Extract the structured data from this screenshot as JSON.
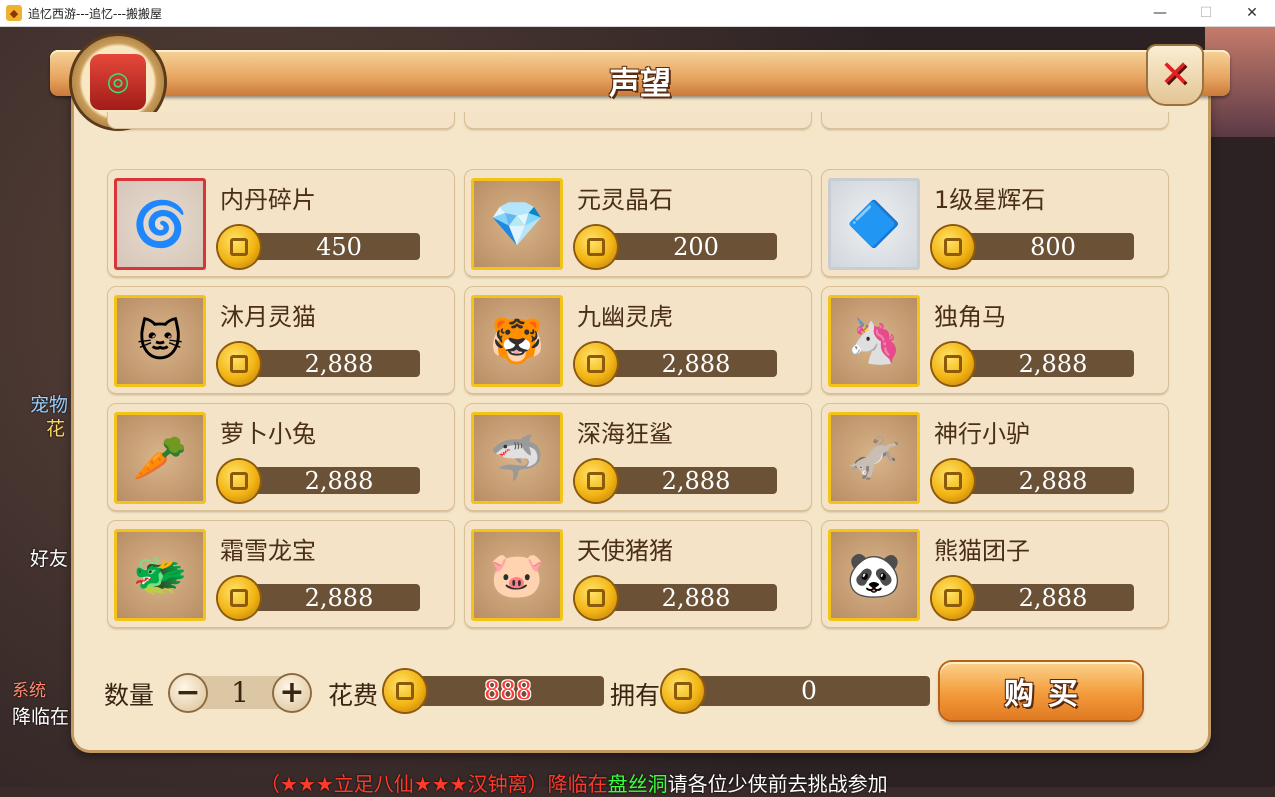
{
  "window": {
    "title": "追忆西游---追忆---搬搬屋",
    "minimize": "—",
    "maximize": "☐",
    "close": "✕"
  },
  "background": {
    "side_texts": [
      "宠物",
      "花",
      "好友",
      "系统",
      "降临在"
    ],
    "bottom_parts": [
      "（★★★立足八仙★★★汉钟离）降临在",
      "盘丝洞",
      "请各位少侠前去挑战参加"
    ]
  },
  "panel": {
    "title": "声望",
    "close_icon": "close-x-icon"
  },
  "items": [
    {
      "name": "内丹碎片",
      "price": "450",
      "icon": "🌀",
      "frame": "red"
    },
    {
      "name": "元灵晶石",
      "price": "200",
      "icon": "💎",
      "frame": "gold"
    },
    {
      "name": "1级星辉石",
      "price": "800",
      "icon": "🔷",
      "frame": "silver"
    },
    {
      "name": "沐月灵猫",
      "price": "2,888",
      "icon": "🐱",
      "frame": "gold"
    },
    {
      "name": "九幽灵虎",
      "price": "2,888",
      "icon": "🐯",
      "frame": "gold"
    },
    {
      "name": "独角马",
      "price": "2,888",
      "icon": "🦄",
      "frame": "gold"
    },
    {
      "name": "萝卜小兔",
      "price": "2,888",
      "icon": "🥕",
      "frame": "gold"
    },
    {
      "name": "深海狂鲨",
      "price": "2,888",
      "icon": "🦈",
      "frame": "gold"
    },
    {
      "name": "神行小驴",
      "price": "2,888",
      "icon": "🫏",
      "frame": "gold"
    },
    {
      "name": "霜雪龙宝",
      "price": "2,888",
      "icon": "🐲",
      "frame": "gold"
    },
    {
      "name": "天使猪猪",
      "price": "2,888",
      "icon": "🐷",
      "frame": "gold"
    },
    {
      "name": "熊猫团子",
      "price": "2,888",
      "icon": "🐼",
      "frame": "gold"
    }
  ],
  "purchase": {
    "qty_label": "数量",
    "qty_value": "1",
    "minus": "−",
    "plus": "+",
    "cost_label": "花费",
    "cost_value": "888",
    "own_label": "拥有",
    "own_value": "0",
    "buy_label": "购买"
  },
  "colors": {
    "panel_bg": "#f5e6c9",
    "bar_bg": "#6b5236",
    "gold_frame": "#f2c419",
    "cost_text": "#ff3c3c"
  }
}
